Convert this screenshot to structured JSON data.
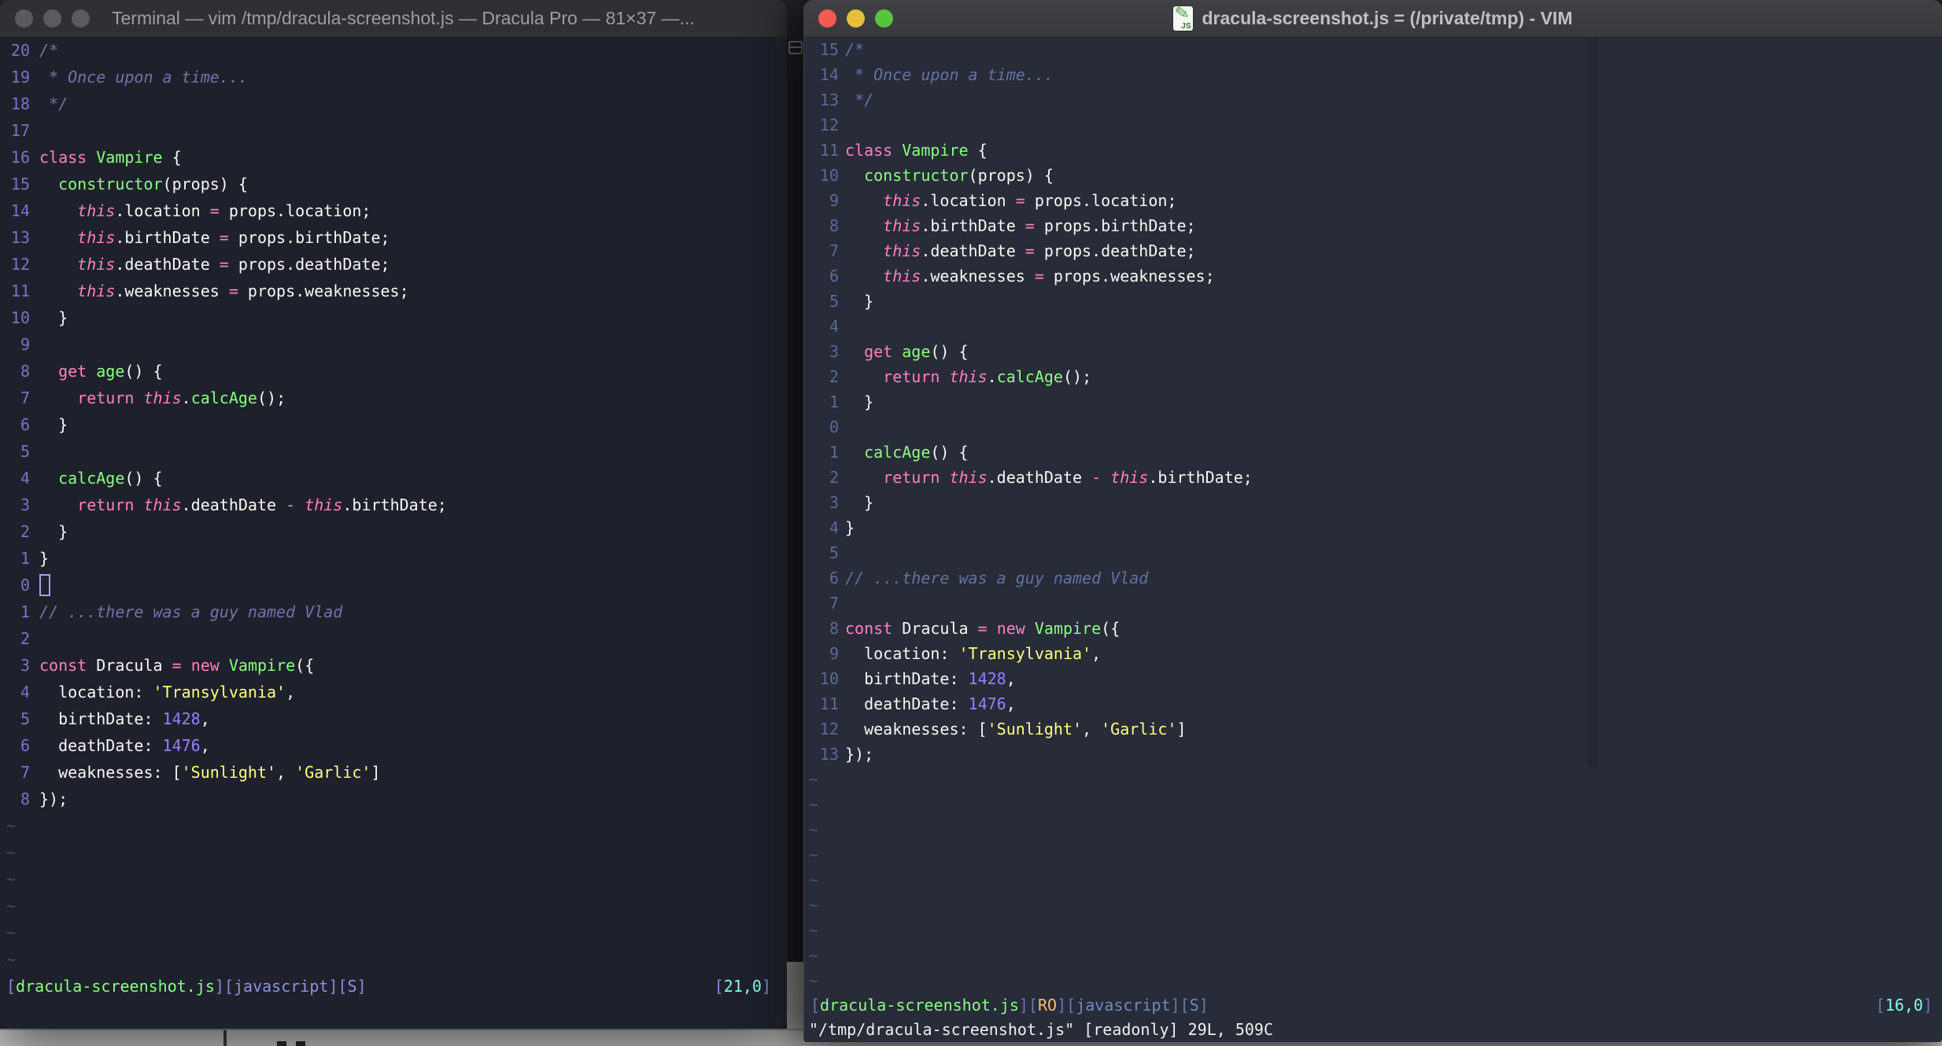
{
  "left_window": {
    "title": "Terminal — vim /tmp/dracula-screenshot.js — Dracula Pro — 81×37 —...",
    "traffic_lights": [
      "close",
      "minimize",
      "zoom"
    ],
    "gutter": [
      "20",
      "19",
      "18",
      "17",
      "16",
      "15",
      "14",
      "13",
      "12",
      "11",
      "10",
      "9",
      "8",
      "7",
      "6",
      "5",
      "4",
      "3",
      "2",
      "1",
      "0",
      "1",
      "2",
      "3",
      "4",
      "5",
      "6",
      "7",
      "8"
    ],
    "tilde_count": 6,
    "cursor_row_index": 20,
    "cursor_style": "hollow-block",
    "status_left": [
      [
        "br",
        "["
      ],
      [
        "file",
        "dracula-screenshot.js"
      ],
      [
        "br",
        "]["
      ],
      [
        "lbl",
        "javascript"
      ],
      [
        "br",
        "]["
      ],
      [
        "lbl",
        "S"
      ],
      [
        "br",
        "]"
      ]
    ],
    "status_right": [
      [
        "br",
        "["
      ],
      [
        "pos",
        "21,0"
      ],
      [
        "br",
        "]"
      ]
    ]
  },
  "right_window": {
    "title": "dracula-screenshot.js = (/private/tmp) - VIM",
    "file_icon": "js-file-icon",
    "traffic_lights": [
      "close",
      "minimize",
      "zoom"
    ],
    "gutter": [
      "15",
      "14",
      "13",
      "12",
      "11",
      "10",
      "9",
      "8",
      "7",
      "6",
      "5",
      "4",
      "3",
      "2",
      "1",
      "0",
      "1",
      "2",
      "3",
      "4",
      "5",
      "6",
      "7",
      "8",
      "9",
      "10",
      "11",
      "12",
      "13"
    ],
    "tilde_count": 9,
    "status_left": [
      [
        "br",
        "["
      ],
      [
        "file",
        "dracula-screenshot.js"
      ],
      [
        "br",
        "]["
      ],
      [
        "ro",
        "RO"
      ],
      [
        "br",
        "]["
      ],
      [
        "lbl",
        "javascript"
      ],
      [
        "br",
        "]["
      ],
      [
        "lbl",
        "S"
      ],
      [
        "br",
        "]"
      ]
    ],
    "status_right": [
      [
        "br",
        "["
      ],
      [
        "pos",
        "16,0"
      ],
      [
        "br",
        "]"
      ]
    ],
    "message_line": "\"/tmp/dracula-screenshot.js\" [readonly] 29L, 509C",
    "has_color_column": true
  },
  "code_lines": [
    [
      [
        "c",
        "/*"
      ]
    ],
    [
      [
        "c",
        " * Once upon a time..."
      ]
    ],
    [
      [
        "c",
        " */"
      ]
    ],
    [],
    [
      [
        "p",
        "class"
      ],
      [
        "f",
        " "
      ],
      [
        "g",
        "Vampire"
      ],
      [
        "f",
        " {"
      ]
    ],
    [
      [
        "f",
        "  "
      ],
      [
        "g",
        "constructor"
      ],
      [
        "f",
        "(props) {"
      ]
    ],
    [
      [
        "f",
        "    "
      ],
      [
        "i",
        "this"
      ],
      [
        "f",
        ".location "
      ],
      [
        "p",
        "="
      ],
      [
        "f",
        " props.location;"
      ]
    ],
    [
      [
        "f",
        "    "
      ],
      [
        "i",
        "this"
      ],
      [
        "f",
        ".birthDate "
      ],
      [
        "p",
        "="
      ],
      [
        "f",
        " props.birthDate;"
      ]
    ],
    [
      [
        "f",
        "    "
      ],
      [
        "i",
        "this"
      ],
      [
        "f",
        ".deathDate "
      ],
      [
        "p",
        "="
      ],
      [
        "f",
        " props.deathDate;"
      ]
    ],
    [
      [
        "f",
        "    "
      ],
      [
        "i",
        "this"
      ],
      [
        "f",
        ".weaknesses "
      ],
      [
        "p",
        "="
      ],
      [
        "f",
        " props.weaknesses;"
      ]
    ],
    [
      [
        "f",
        "  }"
      ]
    ],
    [],
    [
      [
        "f",
        "  "
      ],
      [
        "p",
        "get"
      ],
      [
        "f",
        " "
      ],
      [
        "g",
        "age"
      ],
      [
        "f",
        "() {"
      ]
    ],
    [
      [
        "f",
        "    "
      ],
      [
        "p",
        "return"
      ],
      [
        "f",
        " "
      ],
      [
        "i",
        "this"
      ],
      [
        "f",
        "."
      ],
      [
        "g",
        "calcAge"
      ],
      [
        "f",
        "();"
      ]
    ],
    [
      [
        "f",
        "  }"
      ]
    ],
    [],
    [
      [
        "f",
        "  "
      ],
      [
        "g",
        "calcAge"
      ],
      [
        "f",
        "() {"
      ]
    ],
    [
      [
        "f",
        "    "
      ],
      [
        "p",
        "return"
      ],
      [
        "f",
        " "
      ],
      [
        "i",
        "this"
      ],
      [
        "f",
        ".deathDate "
      ],
      [
        "p",
        "-"
      ],
      [
        "f",
        " "
      ],
      [
        "i",
        "this"
      ],
      [
        "f",
        ".birthDate;"
      ]
    ],
    [
      [
        "f",
        "  }"
      ]
    ],
    [
      [
        "f",
        "}"
      ]
    ],
    [],
    [
      [
        "c",
        "// ...there was a guy named Vlad"
      ]
    ],
    [],
    [
      [
        "p",
        "const"
      ],
      [
        "f",
        " Dracula "
      ],
      [
        "p",
        "="
      ],
      [
        "f",
        " "
      ],
      [
        "p",
        "new"
      ],
      [
        "f",
        " "
      ],
      [
        "g",
        "Vampire"
      ],
      [
        "f",
        "({"
      ]
    ],
    [
      [
        "f",
        "  location: "
      ],
      [
        "y",
        "'Transylvania'"
      ],
      [
        "f",
        ","
      ]
    ],
    [
      [
        "f",
        "  birthDate: "
      ],
      [
        "o",
        "1428"
      ],
      [
        "f",
        ","
      ]
    ],
    [
      [
        "f",
        "  deathDate: "
      ],
      [
        "o",
        "1476"
      ],
      [
        "f",
        ","
      ]
    ],
    [
      [
        "f",
        "  weaknesses: ["
      ],
      [
        "y",
        "'Sunlight'"
      ],
      [
        "f",
        ", "
      ],
      [
        "y",
        "'Garlic'"
      ],
      [
        "f",
        "]"
      ]
    ],
    [
      [
        "f",
        "});"
      ]
    ]
  ],
  "colors": {
    "left_bg": "#1E212C",
    "right_bg": "#282B38",
    "foreground": "#F8F8F2",
    "pink": "#FF80BF",
    "green": "#8AFF80",
    "purple": "#9580FF",
    "yellow": "#FFFF80",
    "cyan": "#80FFEA",
    "left_comment": "#7970A9",
    "right_comment": "#6272A4",
    "left_gutter": "#7874C8",
    "right_gutter": "#5C6A9C",
    "color_column": "#232530",
    "readonly_orange": "#FFB86C",
    "backdrop_strip": "#C8C8C6",
    "traffic_red": "#F35A53",
    "traffic_yellow": "#E6BF3F",
    "traffic_green": "#58C43C",
    "inactive_light": "#595B60"
  }
}
